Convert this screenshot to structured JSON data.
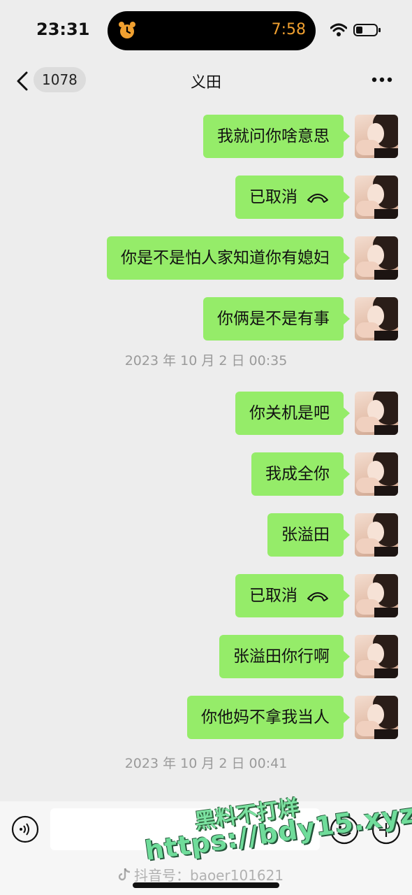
{
  "status_bar": {
    "time": "23:31",
    "island_timer": "7:58",
    "icons": [
      "alarm-icon",
      "wifi-icon",
      "battery-icon"
    ]
  },
  "nav": {
    "unread_count": "1078",
    "title": "义田",
    "icons": [
      "back-icon",
      "more-icon"
    ]
  },
  "messages_block1": [
    {
      "text": "我就问你啥意思",
      "call_icon": false
    },
    {
      "text": "已取消",
      "call_icon": true
    },
    {
      "text": "你是不是怕人家知道你有媳妇",
      "call_icon": false
    },
    {
      "text": "你俩是不是有事",
      "call_icon": false
    }
  ],
  "timestamp1": "2023 年 10 月 2 日  00:35",
  "messages_block2": [
    {
      "text": "你关机是吧",
      "call_icon": false
    },
    {
      "text": "我成全你",
      "call_icon": false
    },
    {
      "text": "张溢田",
      "call_icon": false
    },
    {
      "text": "已取消",
      "call_icon": true
    },
    {
      "text": "张溢田你行啊",
      "call_icon": false
    },
    {
      "text": "你他妈不拿我当人",
      "call_icon": false
    }
  ],
  "timestamp2": "2023 年 10 月 2 日  00:41",
  "input_bar": {
    "placeholder": "",
    "icons": [
      "voice-icon",
      "emoji-icon",
      "plus-icon"
    ]
  },
  "watermark": {
    "line1": "黑料不打烊",
    "line2": "https://bdy15.xyz",
    "tiktok": "抖音号：baoer101621"
  },
  "colors": {
    "bubble": "#95ec69",
    "background": "#ededed",
    "timer": "#f0a030"
  }
}
